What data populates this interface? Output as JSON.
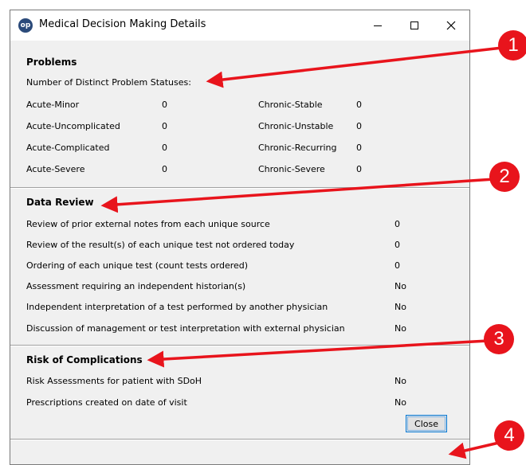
{
  "window": {
    "title": "Medical Decision Making Details",
    "app_icon_text": "op"
  },
  "problems": {
    "heading": "Problems",
    "subheading": "Number of Distinct Problem Statuses:",
    "left": [
      {
        "label": "Acute-Minor",
        "value": "0"
      },
      {
        "label": "Acute-Uncomplicated",
        "value": "0"
      },
      {
        "label": "Acute-Complicated",
        "value": "0"
      },
      {
        "label": "Acute-Severe",
        "value": "0"
      }
    ],
    "right": [
      {
        "label": "Chronic-Stable",
        "value": "0"
      },
      {
        "label": "Chronic-Unstable",
        "value": "0"
      },
      {
        "label": "Chronic-Recurring",
        "value": "0"
      },
      {
        "label": "Chronic-Severe",
        "value": "0"
      }
    ]
  },
  "data_review": {
    "heading": "Data Review",
    "rows": [
      {
        "label": "Review of prior external notes from each unique source",
        "value": "0"
      },
      {
        "label": "Review of the result(s) of each unique test not ordered today",
        "value": "0"
      },
      {
        "label": "Ordering of each unique test (count tests ordered)",
        "value": "0"
      },
      {
        "label": "Assessment requiring an independent historian(s)",
        "value": "No"
      },
      {
        "label": "Independent interpretation of a test performed by another physician",
        "value": "No"
      },
      {
        "label": "Discussion of management or test interpretation with external physician",
        "value": "No"
      }
    ]
  },
  "risk": {
    "heading": "Risk of Complications",
    "rows": [
      {
        "label": "Risk Assessments for patient with SDoH",
        "value": "No"
      },
      {
        "label": "Prescriptions created on date of visit",
        "value": "No"
      }
    ]
  },
  "footer": {
    "close_label": "Close"
  },
  "callouts": [
    "1",
    "2",
    "3",
    "4"
  ],
  "colors": {
    "callout": "#e8141c",
    "dialog_bg": "#f0f0f0",
    "focus_border": "#0078d7"
  }
}
